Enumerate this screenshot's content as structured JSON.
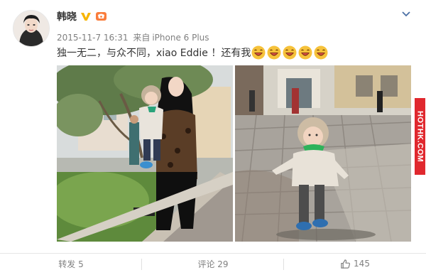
{
  "post": {
    "author": "韩晓",
    "timestamp": "2015-11-7 16:31",
    "source_prefix": "来自",
    "source": "iPhone 6 Plus",
    "text": "独一无二，与众不同，xiao Eddie ！还有我",
    "emoji_count": 5
  },
  "watermark": {
    "text": "HOTHK.COM"
  },
  "actions": {
    "repost_label": "转发 5",
    "comment_label": "评论 29",
    "like_count": "145"
  },
  "colors": {
    "accent_orange": "#fa7d3c",
    "verified_yellow": "#f7b500",
    "watermark_red": "#e0282e",
    "muted_text": "#808080"
  },
  "icons": {
    "verified": "verified-v-icon",
    "vip": "vip-badge-icon",
    "menu": "chevron-down-icon",
    "like": "thumbs-up-icon",
    "emoji": "laughing-face-icon"
  }
}
